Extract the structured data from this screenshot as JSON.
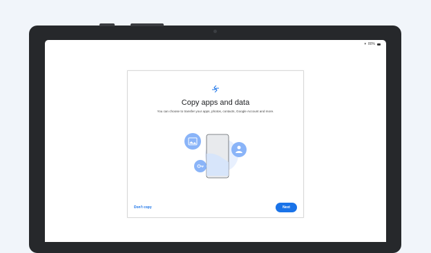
{
  "status_bar": {
    "battery_text": "80%"
  },
  "setup": {
    "title": "Copy apps and data",
    "description": "You can choose to transfer your apps, photos, contacts, Google Account and more.",
    "dont_copy_label": "Don't copy",
    "next_label": "Next"
  },
  "icons": {
    "transfer": "transfer-arrows-icon",
    "photo": "image-icon",
    "contact": "person-icon",
    "account": "key-icon",
    "phone": "phone-illustration"
  },
  "colors": {
    "accent": "#1a73e8",
    "illustration_blue": "#8ab4f8",
    "illustration_light": "#d2e3fc"
  }
}
